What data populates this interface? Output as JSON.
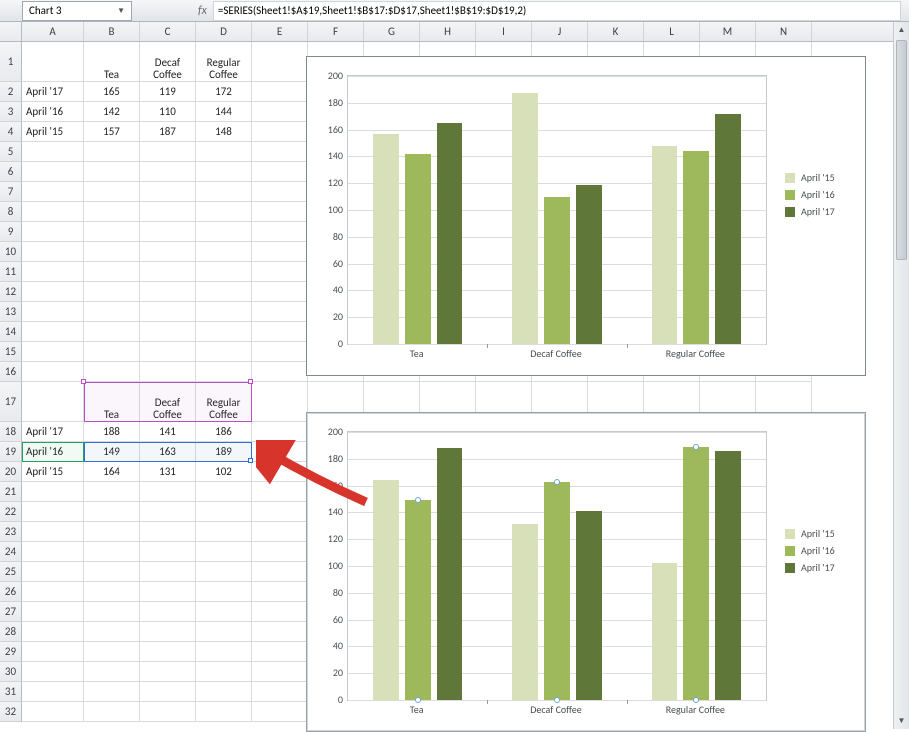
{
  "name_box": "Chart 3",
  "fx_label": "fx",
  "formula": "=SERIES(Sheet1!$A$19,Sheet1!$B$17:$D$17,Sheet1!$B$19:$D$19,2)",
  "columns": [
    "A",
    "B",
    "C",
    "D",
    "E",
    "F",
    "G",
    "H",
    "I",
    "J",
    "K",
    "L",
    "M",
    "N"
  ],
  "row_count": 32,
  "table1": {
    "header_row": 1,
    "headers": {
      "B": "Tea",
      "C": "Decaf\nCoffee",
      "D": "Regular\nCoffee"
    },
    "rows": [
      {
        "r": 2,
        "A": "April '17",
        "B": "165",
        "C": "119",
        "D": "172"
      },
      {
        "r": 3,
        "A": "April '16",
        "B": "142",
        "C": "110",
        "D": "144"
      },
      {
        "r": 4,
        "A": "April '15",
        "B": "157",
        "C": "187",
        "D": "148"
      }
    ]
  },
  "table2": {
    "header_row": 17,
    "headers": {
      "B": "Tea",
      "C": "Decaf\nCoffee",
      "D": "Regular\nCoffee"
    },
    "rows": [
      {
        "r": 18,
        "A": "April '17",
        "B": "188",
        "C": "141",
        "D": "186"
      },
      {
        "r": 19,
        "A": "April '16",
        "B": "149",
        "C": "163",
        "D": "189"
      },
      {
        "r": 20,
        "A": "April '15",
        "B": "164",
        "C": "131",
        "D": "102"
      }
    ]
  },
  "legend_labels": [
    "April '15",
    "April '16",
    "April '17"
  ],
  "category_labels": [
    "Tea",
    "Decaf Coffee",
    "Regular Coffee"
  ],
  "chart_data": [
    {
      "id": "chart1",
      "type": "bar",
      "categories": [
        "Tea",
        "Decaf Coffee",
        "Regular Coffee"
      ],
      "series": [
        {
          "name": "April '15",
          "values": [
            157,
            187,
            148
          ],
          "color": "#d7e0b9"
        },
        {
          "name": "April '16",
          "values": [
            142,
            110,
            144
          ],
          "color": "#9eb95c"
        },
        {
          "name": "April '17",
          "values": [
            165,
            119,
            172
          ],
          "color": "#60773a"
        }
      ],
      "ylim": [
        0,
        200
      ],
      "ytick": 20,
      "title": "",
      "xlabel": "",
      "ylabel": ""
    },
    {
      "id": "chart2",
      "type": "bar",
      "categories": [
        "Tea",
        "Decaf Coffee",
        "Regular Coffee"
      ],
      "series": [
        {
          "name": "April '15",
          "values": [
            164,
            131,
            102
          ],
          "color": "#d7e0b9"
        },
        {
          "name": "April '16",
          "values": [
            149,
            163,
            189
          ],
          "color": "#9eb95c"
        },
        {
          "name": "April '17",
          "values": [
            188,
            141,
            186
          ],
          "color": "#60773a"
        }
      ],
      "ylim": [
        0,
        200
      ],
      "ytick": 20,
      "title": "",
      "xlabel": "",
      "ylabel": "",
      "selected_series_index": 1
    }
  ]
}
